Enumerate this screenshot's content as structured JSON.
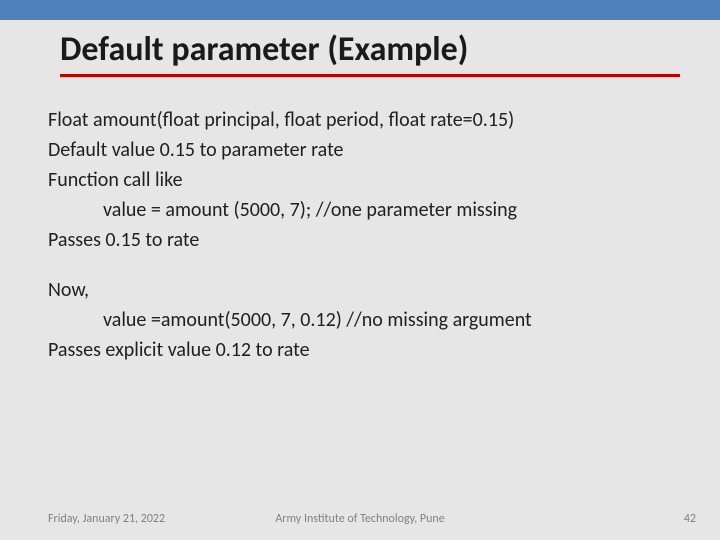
{
  "title": "Default parameter (Example)",
  "lines": {
    "l1": "Float amount(float principal, float period, float rate=0.15)",
    "l2": "Default value 0.15 to parameter rate",
    "l3": "Function call like",
    "l4": "value = amount (5000, 7); //one parameter missing",
    "l5": "Passes 0.15 to rate",
    "l6": "Now,",
    "l7": "value =amount(5000, 7, 0.12) //no missing argument",
    "l8": "Passes explicit value 0.12 to rate"
  },
  "footer": {
    "date": "Friday, January 21, 2022",
    "org": "Army Institute of Technology, Pune",
    "page": "42"
  }
}
